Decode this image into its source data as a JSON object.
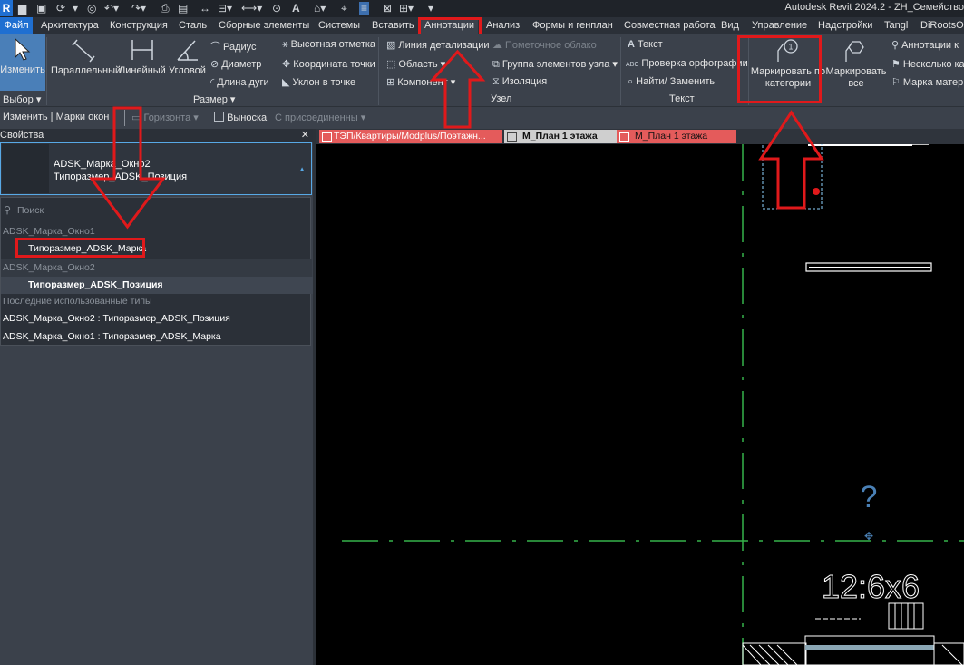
{
  "title_bar": {
    "app_logo": "R",
    "window_title": "Autodesk Revit 2024.2 - ZH_Семейство",
    "quick_access_text_icon": "A"
  },
  "menu": {
    "tabs": [
      "Файл",
      "Архитектура",
      "Конструкция",
      "Сталь",
      "Сборные элементы",
      "Системы",
      "Вставить",
      "Аннотации",
      "Анализ",
      "Формы и генплан",
      "Совместная работа",
      "Вид",
      "Управление",
      "Надстройки",
      "Tangl",
      "DiRootsOne"
    ],
    "active": "Аннотации"
  },
  "ribbon": {
    "select": {
      "modify_label": "Изменить",
      "panel_label": "Выбор"
    },
    "dimension": {
      "aligned": "Параллельный",
      "linear": "Линейный",
      "angular": "Угловой",
      "radius": "Радиус",
      "diameter": "Диаметр",
      "arc_length": "Длина дуги",
      "spot_elevation": "Высотная отметка",
      "spot_coordinate": "Координата точки",
      "spot_slope": "Уклон  в точке",
      "panel_label": "Размер"
    },
    "detail": {
      "detail_line": "Линия детализации",
      "revision_cloud": "Пометочное облако",
      "region": "Область",
      "detail_group": "Группа элементов узла",
      "component": "Компонент",
      "insulation": "Изоляция",
      "panel_label": "Узел"
    },
    "text": {
      "text": "Текст",
      "spelling": "Проверка  орфографии",
      "find_replace": "Найти/ Заменить",
      "spelling_icon_text": "ABC",
      "panel_label": "Текст"
    },
    "tag": {
      "tag_by_category": "Маркировать по категории",
      "tag_all": "Маркировать все",
      "annotations": "Аннотации к",
      "multiple": "Несколько ка",
      "material_tag": "Марка матери",
      "tag_icon_number": "1"
    }
  },
  "options_bar": {
    "context": "Изменить | Марки окон",
    "orientation": "Горизонта",
    "leader": "Выноска",
    "attached": "С присоединенны"
  },
  "properties": {
    "title": "Свойства",
    "family": "ADSK_Марка_Окно2",
    "type": "Типоразмер_ADSK_Позиция",
    "search_placeholder": "Поиск",
    "groups": [
      {
        "family": "ADSK_Марка_Окно1",
        "item": "Типоразмер_ADSK_Марка"
      },
      {
        "family": "ADSK_Марка_Окно2",
        "item": "Типоразмер_ADSK_Позиция"
      }
    ],
    "recent_label": "Последние использованные типы",
    "recent": [
      "ADSK_Марка_Окно2 : Типоразмер_ADSK_Позиция",
      "ADSK_Марка_Окно1 : Типоразмер_ADSK_Марка"
    ]
  },
  "view_tabs": [
    {
      "label": "ТЭП/Квартиры/Modplus/Поэтажн...",
      "color": "#e45b5b"
    },
    {
      "label": "М_План 1 этажа",
      "color": "#cfcfcf"
    },
    {
      "label": "М_План 1 этажа",
      "color": "#e45b5b"
    }
  ],
  "canvas": {
    "tag_question": "?",
    "dimension_text": "12:6x6"
  },
  "colors": {
    "highlight": "#e0191b",
    "accent_blue": "#1f6fd1",
    "grid_line": "#35b24a"
  }
}
